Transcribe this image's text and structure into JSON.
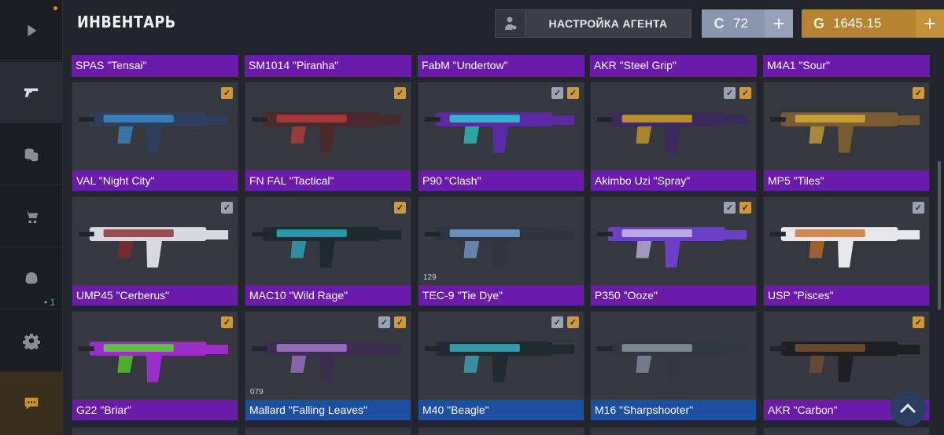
{
  "header": {
    "title": "ИНВЕНТАРЬ",
    "agent_label": "НАСТРОЙКА АГЕНТА",
    "silver": {
      "icon": "silver-coin-icon",
      "value": "72",
      "plus": "+"
    },
    "gold": {
      "icon": "gold-coin-icon",
      "value": "1645.15",
      "plus": "+"
    }
  },
  "sidebar": {
    "items": [
      {
        "name": "play",
        "icon": "play-icon"
      },
      {
        "name": "weapons",
        "icon": "pistol-icon"
      },
      {
        "name": "coins",
        "icon": "coins-icon"
      },
      {
        "name": "shop",
        "icon": "cart-icon"
      },
      {
        "name": "agent",
        "icon": "helmet-icon",
        "badge": "• 1"
      },
      {
        "name": "settings",
        "icon": "gear-icon"
      },
      {
        "name": "chat",
        "icon": "chat-icon"
      }
    ]
  },
  "top_strip": [
    "SPAS \"Tensai\"",
    "SM1014 \"Piranha\"",
    "FabM \"Undertow\"",
    "AKR \"Steel Grip\"",
    "M4A1 \"Sour\""
  ],
  "rows": [
    [
      {
        "name": "VAL \"Night City\"",
        "rarity": "purple",
        "checks": [
          "gold"
        ]
      },
      {
        "name": "FN FAL \"Tactical\"",
        "rarity": "purple",
        "checks": [
          "gold"
        ]
      },
      {
        "name": "P90 \"Clash\"",
        "rarity": "purple",
        "checks": [
          "grey",
          "gold"
        ]
      },
      {
        "name": "Akimbo Uzi \"Spray\"",
        "rarity": "purple",
        "checks": [
          "grey",
          "gold"
        ]
      },
      {
        "name": "MP5 \"Tiles\"",
        "rarity": "purple",
        "checks": [
          "gold"
        ]
      }
    ],
    [
      {
        "name": "UMP45 \"Cerberus\"",
        "rarity": "purple",
        "checks": [
          "grey"
        ]
      },
      {
        "name": "MAC10 \"Wild Rage\"",
        "rarity": "purple",
        "checks": [
          "gold"
        ]
      },
      {
        "name": "TEC-9 \"Tie Dye\"",
        "rarity": "purple",
        "checks": [],
        "level": "129"
      },
      {
        "name": "P350 \"Ooze\"",
        "rarity": "purple",
        "checks": [
          "grey",
          "gold"
        ]
      },
      {
        "name": "USP \"Pisces\"",
        "rarity": "purple",
        "checks": [
          "grey"
        ]
      }
    ],
    [
      {
        "name": "G22 \"Briar\"",
        "rarity": "purple",
        "checks": [
          "gold"
        ]
      },
      {
        "name": "Mallard \"Falling Leaves\"",
        "rarity": "blue",
        "checks": [
          "grey",
          "gold"
        ],
        "level": "079"
      },
      {
        "name": "M40 \"Beagle\"",
        "rarity": "blue",
        "checks": [
          "grey",
          "gold"
        ]
      },
      {
        "name": "M16 \"Sharpshooter\"",
        "rarity": "blue",
        "checks": []
      },
      {
        "name": "AKR \"Carbon\"",
        "rarity": "purple",
        "checks": [
          "gold"
        ]
      }
    ]
  ],
  "colors": {
    "purple": "#6a1ba9",
    "blue": "#1c4fa3",
    "gold": "#b68430",
    "silver": "#8a96ad"
  }
}
